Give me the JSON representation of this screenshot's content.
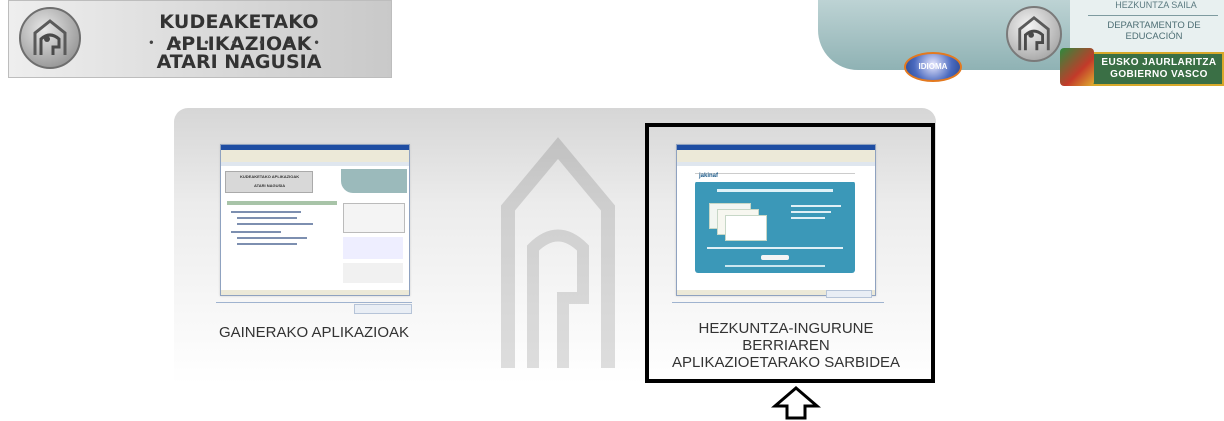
{
  "header": {
    "title_line1": "KUDEAKETAKO APLIKAZIOAK",
    "dots": "• • • • • • •",
    "title_line2": "ATARI NAGUSIA",
    "right_top_text": "HEZKUNTZA SAILA",
    "department": "DEPARTAMENTO DE EDUCACIÓN",
    "language_button": "IDIOMA",
    "gov_line1": "EUSKO JAURLARITZA",
    "gov_line2": "GOBIERNO VASCO"
  },
  "options": [
    {
      "label": "GAINERAKO APLIKAZIOAK",
      "selected": false
    },
    {
      "label_line1": "HEZKUNTZA-INGURUNE BERRIAREN",
      "label_line2": "APLIKAZIOETARAKO SARBIDEA",
      "selected": true
    }
  ],
  "screenshot_left": {
    "banner_title": "KUDEAKETAKO APLIKAZIOAK",
    "banner_sub": "ATARI NAGUSIA"
  },
  "screenshot_right": {
    "brand": "jakinaf"
  }
}
